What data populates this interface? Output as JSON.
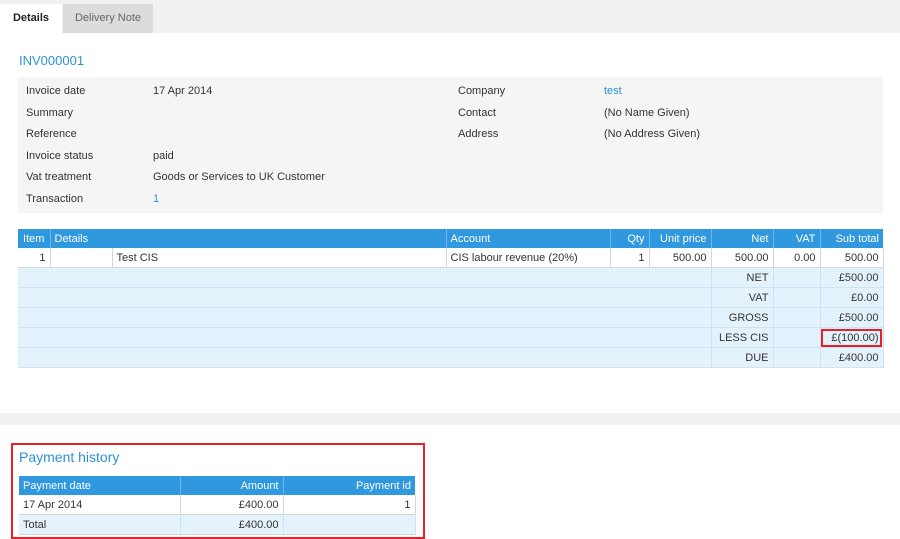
{
  "tabs": [
    {
      "label": "Details",
      "active": true
    },
    {
      "label": "Delivery Note",
      "active": false
    }
  ],
  "invoice_number": "INV000001",
  "details_left": [
    {
      "label": "Invoice date",
      "value": "17 Apr 2014"
    },
    {
      "label": "Summary",
      "value": ""
    },
    {
      "label": "Reference",
      "value": ""
    },
    {
      "label": "Invoice status",
      "value": "paid"
    },
    {
      "label": "Vat treatment",
      "value": "Goods or Services to UK Customer"
    },
    {
      "label": "Transaction",
      "value": "1"
    }
  ],
  "details_right": [
    {
      "label": "Company",
      "value": "test"
    },
    {
      "label": "Contact",
      "value": "(No Name Given)"
    },
    {
      "label": "Address",
      "value": "(No Address Given)"
    }
  ],
  "items_table": {
    "headers": [
      "Item",
      "Details",
      "Account",
      "Qty",
      "Unit price",
      "Net",
      "VAT",
      "Sub total"
    ],
    "rows": [
      {
        "item": "1",
        "details": "Test CIS",
        "account": "CIS labour revenue (20%)",
        "qty": "1",
        "unit_price": "500.00",
        "net": "500.00",
        "vat": "0.00",
        "sub_total": "500.00"
      }
    ],
    "totals": [
      {
        "label": "NET",
        "value": "£500.00"
      },
      {
        "label": "VAT",
        "value": "£0.00"
      },
      {
        "label": "GROSS",
        "value": "£500.00"
      },
      {
        "label": "LESS CIS",
        "value": "£(100.00)"
      },
      {
        "label": "DUE",
        "value": "£400.00"
      }
    ]
  },
  "payment_history": {
    "title": "Payment history",
    "headers": [
      "Payment date",
      "Amount",
      "Payment id"
    ],
    "rows": [
      {
        "date": "17 Apr 2014",
        "amount": "£400.00",
        "id": "1"
      }
    ],
    "total_label": "Total",
    "total_amount": "£400.00"
  },
  "colors": {
    "accent": "#2f98df",
    "link": "#2e91d6",
    "highlight": "#e8202a",
    "totals_bg": "#e4f2fc"
  }
}
